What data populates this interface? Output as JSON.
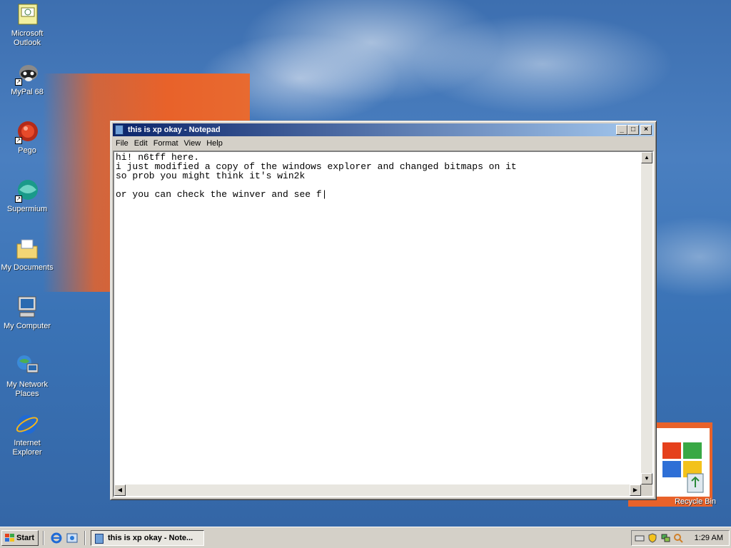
{
  "desktop": {
    "icons": [
      {
        "label_lines": [
          "Microsoft",
          "Outlook"
        ],
        "icon": "outlook-icon"
      },
      {
        "label_lines": [
          "MyPal 68"
        ],
        "icon": "raccoon-icon"
      },
      {
        "label_lines": [
          "Pego"
        ],
        "icon": "pego-icon"
      },
      {
        "label_lines": [
          "Supermium"
        ],
        "icon": "supermium-icon"
      },
      {
        "label_lines": [
          "My Documents"
        ],
        "icon": "folder-icon"
      },
      {
        "label_lines": [
          "My Computer"
        ],
        "icon": "computer-icon"
      },
      {
        "label_lines": [
          "My Network",
          "Places"
        ],
        "icon": "network-icon"
      },
      {
        "label_lines": [
          "Internet",
          "Explorer"
        ],
        "icon": "ie-icon"
      }
    ],
    "recycle_bin_label": "Recycle Bin"
  },
  "window": {
    "title": "this is xp okay - Notepad",
    "controls": {
      "minimize": "_",
      "maximize": "□",
      "close": "×"
    },
    "menu": [
      "File",
      "Edit",
      "Format",
      "View",
      "Help"
    ],
    "content": "hi! n6tff here.\ni just modified a copy of the windows explorer and changed bitmaps on it\nso prob you might think it's win2k\n\nor you can check the winver and see f|"
  },
  "taskbar": {
    "start_label": "Start",
    "task_label": "this is xp okay - Note...",
    "clock": "1:29 AM"
  },
  "colors": {
    "desktop": "#3a6ea5",
    "titlebar_start": "#0a246a",
    "titlebar_end": "#a6caf0",
    "accent_orange": "#e8622a"
  }
}
